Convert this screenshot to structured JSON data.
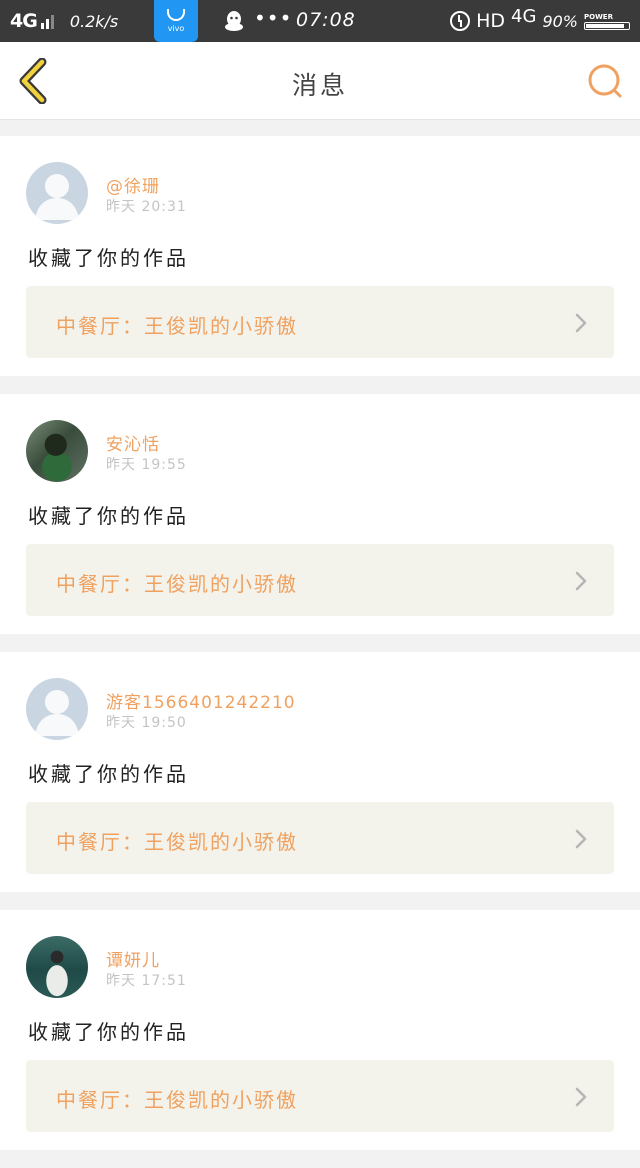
{
  "status_bar": {
    "network": "4G",
    "speed": "0.2k/s",
    "app_badge": "vivo",
    "more": "•••",
    "time": "07:08",
    "hd": "HD",
    "network2": "4G",
    "battery_pct": "90%",
    "battery_label": "POWER",
    "battery_level": 0.9
  },
  "header": {
    "title": "消息"
  },
  "theme": {
    "accent": "#f0a15f",
    "link_bg": "#f3f3ec"
  },
  "messages": [
    {
      "user": "@徐珊",
      "time": "昨天 20:31",
      "action": "收藏了你的作品",
      "work": "中餐厅：王俊凯的小骄傲",
      "avatar": "default-avatar"
    },
    {
      "user": "安沁恬",
      "time": "昨天 19:55",
      "action": "收藏了你的作品",
      "work": "中餐厅：王俊凯的小骄傲",
      "avatar": "photo-avatar"
    },
    {
      "user": "游客1566401242210",
      "time": "昨天 19:50",
      "action": "收藏了你的作品",
      "work": "中餐厅：王俊凯的小骄傲",
      "avatar": "default-avatar"
    },
    {
      "user": "谭妍儿",
      "time": "昨天 17:51",
      "action": "收藏了你的作品",
      "work": "中餐厅：王俊凯的小骄傲",
      "avatar": "photo-avatar"
    }
  ]
}
